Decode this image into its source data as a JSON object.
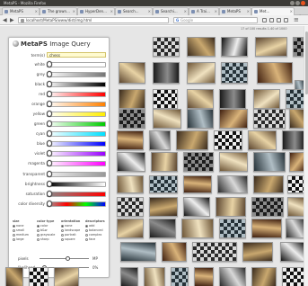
{
  "window": {
    "title": "MetaPS - Mozilla Firefox"
  },
  "tabs": [
    {
      "label": "MetaPS"
    },
    {
      "label": "The grown..."
    },
    {
      "label": "HyperDen..."
    },
    {
      "label": "Search..."
    },
    {
      "label": "Searchi..."
    },
    {
      "label": "A Trai..."
    },
    {
      "label": "MetaPS"
    },
    {
      "label": "Met..."
    }
  ],
  "nav": {
    "url": "localhost/MetaPS/www/dist/img.html",
    "search_placeholder": "Google",
    "new_tab": "+"
  },
  "panel": {
    "title_prefix": "MetaPS",
    "title_rest": " Image Query",
    "terms_label": "term(s)",
    "terms_value": "chess",
    "colors": [
      {
        "label": "white",
        "grad": "linear-gradient(90deg,#ffffff,#ffffff)"
      },
      {
        "label": "grey",
        "grad": "linear-gradient(90deg,#ffffff,#777777)"
      },
      {
        "label": "black",
        "grad": "linear-gradient(90deg,#ffffff,#000000)"
      },
      {
        "label": "red",
        "grad": "linear-gradient(90deg,#ffffff,#ff0000)"
      },
      {
        "label": "orange",
        "grad": "linear-gradient(90deg,#ffffff,#ff8000)"
      },
      {
        "label": "yellow",
        "grad": "linear-gradient(90deg,#ffffff,#ffee00)"
      },
      {
        "label": "green",
        "grad": "linear-gradient(90deg,#ffffff,#00cc00)"
      },
      {
        "label": "cyan",
        "grad": "linear-gradient(90deg,#ffffff,#00e0ff)"
      },
      {
        "label": "blue",
        "grad": "linear-gradient(90deg,#ffffff,#0000ff)"
      },
      {
        "label": "violet",
        "grad": "linear-gradient(90deg,#ffffff,#9900ff)"
      },
      {
        "label": "magenta",
        "grad": "linear-gradient(90deg,#ffffff,#ff00ff)"
      }
    ],
    "sliders": [
      {
        "label": "transparent",
        "grad": "linear-gradient(90deg,#eeeeee,#999999)"
      },
      {
        "label": "brightness",
        "grad": "linear-gradient(90deg,#000000,#ffffff)"
      },
      {
        "label": "saturation",
        "grad": "linear-gradient(90deg,#888888,#ff0000)"
      },
      {
        "label": "color diversity",
        "grad": "linear-gradient(90deg,#999999,#ff0000,#00ff00,#0000ff)"
      }
    ],
    "option_groups": [
      {
        "heading": "size",
        "options": [
          "none",
          "small",
          "medium",
          "large"
        ],
        "selected": 0
      },
      {
        "heading": "color type",
        "options": [
          "color",
          "b&w",
          "grayscale",
          "sharp"
        ],
        "selected": 0
      },
      {
        "heading": "orientation",
        "options": [
          "none",
          "landscape",
          "portrait",
          "square"
        ],
        "selected": 0
      },
      {
        "heading": "descriptors",
        "options": [
          "add",
          "balanced",
          "complex",
          "face"
        ],
        "selected": 0
      }
    ],
    "bottom": [
      {
        "label": "pixels",
        "value": "MP",
        "pos": 0.55
      },
      {
        "label": "likelihood",
        "value": "0%",
        "pos": 0.05
      }
    ]
  },
  "results": {
    "info": "17 of 100 results  1-40 of 1000"
  }
}
